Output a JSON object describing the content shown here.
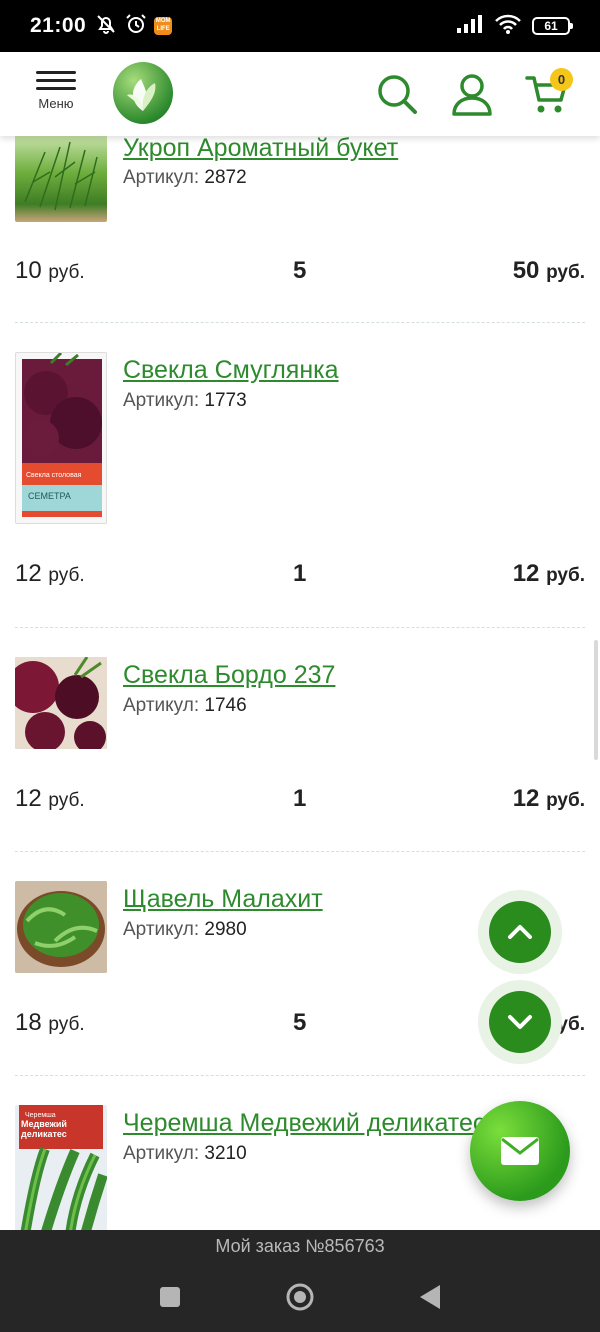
{
  "status_bar": {
    "time": "21:00",
    "app_icon_text": "MOM LIFE",
    "battery": "61"
  },
  "header": {
    "menu_label": "Меню",
    "cart_count": "0",
    "brand_color": "#2d8a2d"
  },
  "products": [
    {
      "name": "Укроп Ароматный букет",
      "sku_label": "Артикул:",
      "sku": "2872",
      "price": "10",
      "price_unit": "руб.",
      "qty": "5",
      "total": "50",
      "total_unit": "руб."
    },
    {
      "name": "Свекла Смуглянка",
      "sku_label": "Артикул:",
      "sku": "1773",
      "price": "12",
      "price_unit": "руб.",
      "qty": "1",
      "total": "12",
      "total_unit": "руб.",
      "package_top": "Свекла столовая",
      "package_brand": "СЕМЕТРА"
    },
    {
      "name": "Свекла Бордо 237",
      "sku_label": "Артикул:",
      "sku": "1746",
      "price": "12",
      "price_unit": "руб.",
      "qty": "1",
      "total": "12",
      "total_unit": "руб."
    },
    {
      "name": "Щавель Малахит",
      "sku_label": "Артикул:",
      "sku": "2980",
      "price": "18",
      "price_unit": "руб.",
      "qty": "5",
      "total": "",
      "total_unit": "руб."
    },
    {
      "name": "Черемша Медвежий деликатес",
      "sku_label": "Артикул:",
      "sku": "3210",
      "package_top": "Черемша",
      "package_title": "Медвежий деликатес"
    }
  ],
  "order_bar": {
    "text": "Мой заказ №856763"
  }
}
